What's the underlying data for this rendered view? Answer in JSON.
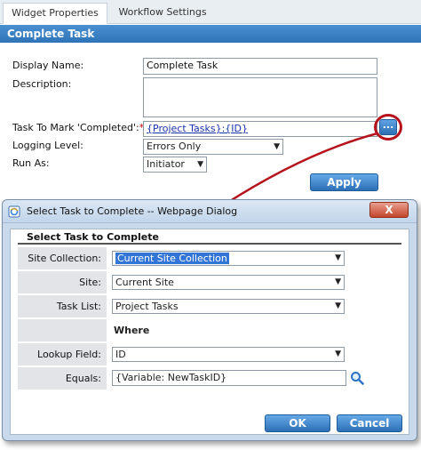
{
  "widget": {
    "tabs": [
      {
        "label": "Widget Properties",
        "active": true
      },
      {
        "label": "Workflow Settings",
        "active": false
      }
    ],
    "header": "Complete Task",
    "display_name_label": "Display Name:",
    "display_name_value": "Complete Task",
    "description_label": "Description:",
    "description_value": "",
    "task_label": "Task To Mark 'Completed':",
    "task_required_mark": "*",
    "task_value": "{Project Tasks}:{ID}",
    "picker_label": "...",
    "logging_label": "Logging Level:",
    "logging_value": "Errors Only",
    "run_as_label": "Run As:",
    "run_as_value": "Initiator",
    "apply_label": "Apply"
  },
  "dialog": {
    "title": "Select Task to Complete -- Webpage Dialog",
    "close_label": "X",
    "header": "Select Task to Complete",
    "site_collection_label": "Site Collection:",
    "site_collection_value": "Current Site Collection",
    "site_label": "Site:",
    "site_value": "Current Site",
    "task_list_label": "Task List:",
    "task_list_value": "Project Tasks",
    "where_label": "Where",
    "lookup_field_label": "Lookup Field:",
    "lookup_field_value": "ID",
    "equals_label": "Equals:",
    "equals_value": "{Variable: NewTaskID}",
    "ok_label": "OK",
    "cancel_label": "Cancel"
  },
  "colors": {
    "header_blue": "#2f74b8",
    "highlight_red": "#b5121b",
    "selection_blue": "#3375d6"
  },
  "icons": [
    "picker-icon",
    "ie-page-icon",
    "close-icon",
    "magnifier-icon",
    "dropdown-caret-icon"
  ]
}
